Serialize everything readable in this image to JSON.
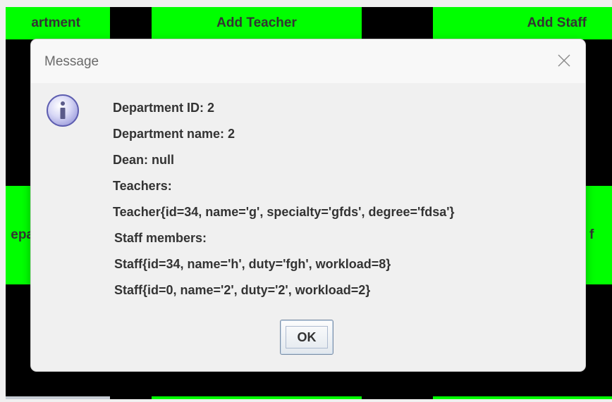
{
  "background_buttons": {
    "row1": {
      "department": "artment",
      "teacher": "Add Teacher",
      "staff": "Add Staff"
    },
    "row2": {
      "left": "epa",
      "right": "f"
    }
  },
  "dialog": {
    "title": "Message",
    "icon": "info-icon",
    "lines": [
      "Department ID: 2",
      "Department name: 2",
      "Dean: null",
      "Teachers:",
      "Teacher{id=34, name='g', specialty='gfds', degree='fdsa'}",
      "Staff members:",
      "Staff{id=34, name='h', duty='fgh', workload=8}",
      "Staff{id=0, name='2', duty='2', workload=2}"
    ],
    "ok_label": "OK"
  },
  "colors": {
    "button_green": "#00ff00",
    "backdrop": "#000000",
    "dialog_bg": "#f0f0f0"
  }
}
